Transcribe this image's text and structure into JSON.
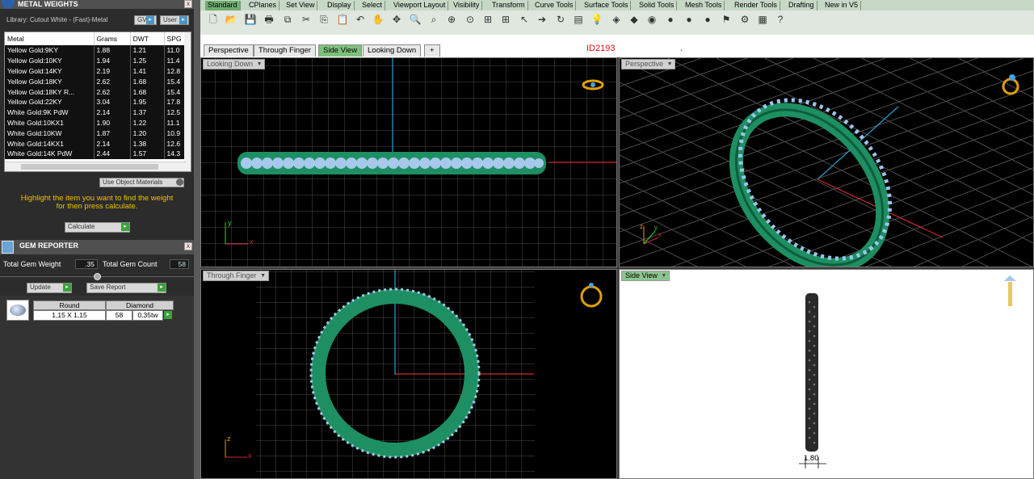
{
  "metal_weights": {
    "title": "METAL WEIGHTS",
    "library": "Library: Cutout White - (Fast)-Metal",
    "btn_gv": "GV",
    "btn_user": "User",
    "columns": [
      "Metal",
      "Grams",
      "DWT",
      "SPG"
    ],
    "rows": [
      [
        "Yellow Gold:9KY",
        "1.88",
        "1.21",
        "11.0"
      ],
      [
        "Yellow Gold:10KY",
        "1.94",
        "1.25",
        "11.4"
      ],
      [
        "Yellow Gold:14KY",
        "2.19",
        "1.41",
        "12.8"
      ],
      [
        "Yellow Gold:18KY",
        "2.62",
        "1.68",
        "15.4"
      ],
      [
        "Yellow Gold:18KY R...",
        "2.62",
        "1.68",
        "15.4"
      ],
      [
        "Yellow Gold:22KY",
        "3.04",
        "1.95",
        "17.8"
      ],
      [
        "White Gold:9K PdW",
        "2.14",
        "1.37",
        "12.5"
      ],
      [
        "White Gold:10KX1",
        "1.90",
        "1.22",
        "11.1"
      ],
      [
        "White Gold:10KW",
        "1.87",
        "1.20",
        "10.9"
      ],
      [
        "White Gold:14KX1",
        "2.14",
        "1.38",
        "12.6"
      ],
      [
        "White Gold:14K PdW",
        "2.44",
        "1.57",
        "14.3"
      ]
    ],
    "use_object_materials": "Use Object Materials",
    "instruction_line1": "Highlight the item you want to find the weight",
    "instruction_line2": "for then press calculate.",
    "calculate": "Calculate"
  },
  "gem_reporter": {
    "title": "GEM REPORTER",
    "total_weight_label": "Total Gem Weight",
    "total_weight_value": ".35",
    "total_count_label": "Total Gem Count",
    "total_count_value": "58",
    "update": "Update",
    "save_report": "Save Report",
    "shape": "Round",
    "type": "Diamond",
    "size": "1,15 X 1,15",
    "count": "58",
    "weight": "0,35tw"
  },
  "toolbar_tabs": [
    "Standard",
    "CPlanes",
    "Set View",
    "Display",
    "Select",
    "Viewport Layout",
    "Visibility",
    "Transform",
    "Curve Tools",
    "Surface Tools",
    "Solid Tools",
    "Mesh Tools",
    "Render Tools",
    "Drafting",
    "New in V5"
  ],
  "viewport_tabs": [
    "Perspective",
    "Through Finger",
    "Side View",
    "Looking Down"
  ],
  "viewport_tab_add": "+",
  "id_label": "ID2193",
  "id_dot": ".",
  "viewports": {
    "top_left": {
      "label": "Looking Down",
      "axis_x": "x",
      "axis_y": "y"
    },
    "top_right": {
      "label": "Perspective",
      "axis_x": "x",
      "axis_y": "y",
      "axis_z": "z"
    },
    "bottom_left": {
      "label": "Through Finger",
      "axis_x": "x",
      "axis_z": "z"
    },
    "bottom_right": {
      "label": "Side View",
      "dimension": "1.80"
    }
  },
  "colors": {
    "ring": "#1d8f62",
    "gem": "#a6c8ea",
    "active_tab": "#7ec07e"
  }
}
